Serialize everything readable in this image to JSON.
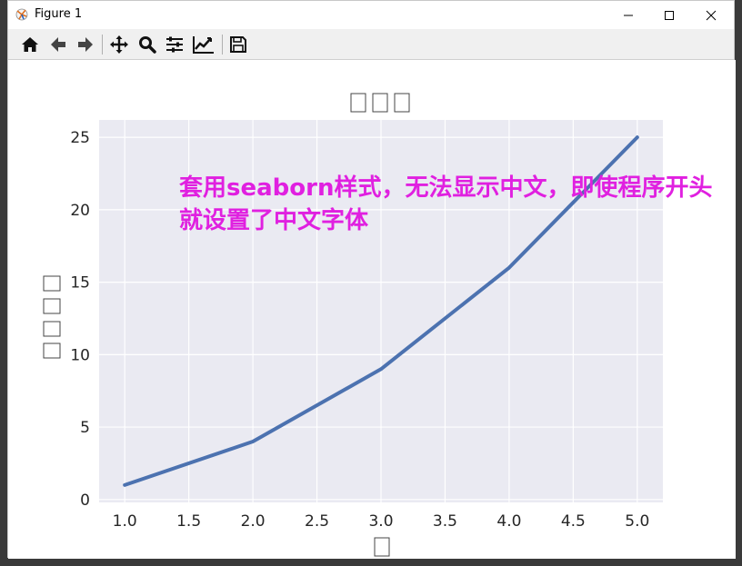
{
  "window": {
    "title": "Figure 1"
  },
  "toolbar": {
    "buttons": [
      {
        "icon": "home-icon"
      },
      {
        "icon": "back-arrow-icon"
      },
      {
        "icon": "forward-arrow-icon"
      },
      {
        "icon": "pan-icon"
      },
      {
        "icon": "zoom-icon"
      },
      {
        "icon": "subplots-config-icon"
      },
      {
        "icon": "edit-axis-icon"
      },
      {
        "icon": "save-icon"
      }
    ]
  },
  "annotation": "套用seaborn样式，无法显示中文，即使程序开头就设置了中文字体",
  "chart_data": {
    "type": "line",
    "title": "□□□",
    "xlabel": "□",
    "ylabel": "□□□□",
    "x": [
      1,
      2,
      3,
      4,
      5
    ],
    "series": [
      {
        "values": [
          1,
          4,
          9,
          16,
          25
        ]
      }
    ],
    "xlim": [
      0.8,
      5.2
    ],
    "ylim": [
      -0.2,
      26.2
    ],
    "xticks": [
      "1.0",
      "1.5",
      "2.0",
      "2.5",
      "3.0",
      "3.5",
      "4.0",
      "4.5",
      "5.0"
    ],
    "yticks": [
      "0",
      "5",
      "10",
      "15",
      "20",
      "25"
    ],
    "grid": true,
    "style": "seaborn",
    "colors": {
      "line": "#4c72b0",
      "plot_background": "#eaeaf2",
      "annotation": "#e020e0"
    }
  }
}
